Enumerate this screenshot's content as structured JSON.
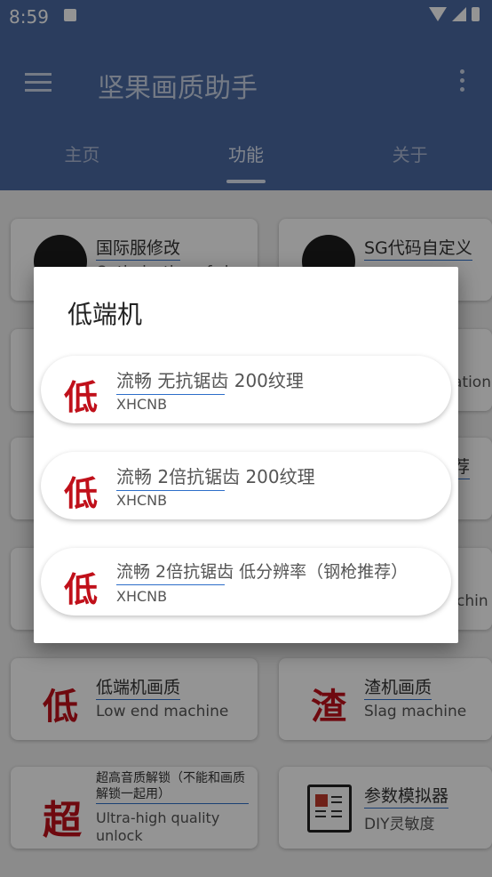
{
  "status_bar": {
    "time": "8:59"
  },
  "app_bar": {
    "title": "坚果画质助手"
  },
  "tabs": [
    {
      "label": "主页"
    },
    {
      "label": "功能"
    },
    {
      "label": "关于"
    }
  ],
  "cards": {
    "intl": {
      "title": "国际服修改",
      "subtitle": "Optimization of slag"
    },
    "sg": {
      "title": "SG代码自定义",
      "subtitle": ""
    },
    "low_end": {
      "glyph": "低",
      "title": "低端机画质",
      "subtitle": "Low end machine"
    },
    "slag": {
      "glyph": "渣",
      "title": "渣机画质",
      "subtitle": "Slag machine"
    },
    "ultra": {
      "glyph": "超",
      "title": "超高音质解锁（不能和画质解锁一起用）",
      "subtitle": "Ultra-high quality unlock"
    },
    "params": {
      "title": "参数模拟器",
      "subtitle": "DIY灵敏度"
    },
    "peek_right_2": "ation",
    "peek_right_3": "荐",
    "peek_right_4": "chin"
  },
  "dialog": {
    "title": "低端机",
    "options": [
      {
        "glyph": "低",
        "title": "流畅 无抗锯齿 200纹理",
        "subtitle": "XHCNB"
      },
      {
        "glyph": "低",
        "title": "流畅 2倍抗锯齿 200纹理",
        "subtitle": "XHCNB"
      },
      {
        "glyph": "低",
        "title": "流畅 2倍抗锯齿  低分辨率（钢枪推荐）",
        "subtitle": "XHCNB"
      }
    ]
  },
  "colors": {
    "primary": "#4a6aa3",
    "accent": "#2d6ec9",
    "glyph_red": "#c0101a"
  }
}
